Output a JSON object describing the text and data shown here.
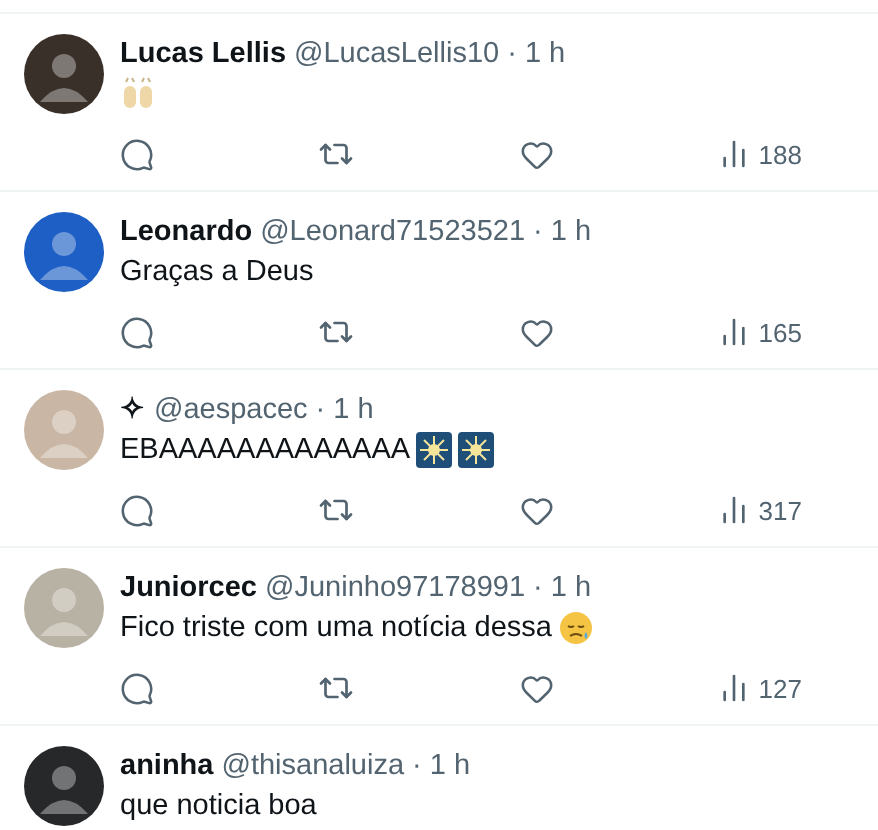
{
  "replies": [
    {
      "name": "Lucas Lellis",
      "handle": "@LucasLellis10",
      "separator": "·",
      "time": "1 h",
      "emojis": [
        {
          "kind": "raised-hands"
        }
      ],
      "views": "188",
      "avatar": {
        "color": "#3a302a"
      }
    },
    {
      "name": "Leonardo",
      "handle": "@Leonard71523521",
      "separator": "·",
      "time": "1 h",
      "text": "Graças a Deus",
      "views": "165",
      "avatar": {
        "color": "#1d5fc4"
      }
    },
    {
      "name": "✧",
      "handle": "@aespacec",
      "separator": "·",
      "time": "1 h",
      "text": "EBAAAAAAAAAAAAA",
      "emojis": [
        {
          "kind": "fireworks"
        },
        {
          "kind": "fireworks"
        }
      ],
      "views": "317",
      "avatar": {
        "color": "#c9b6a4"
      }
    },
    {
      "name": "Juniorcec",
      "handle": "@Juninho97178991",
      "separator": "·",
      "time": "1 h",
      "text": "Fico triste com uma notícia dessa",
      "emojis": [
        {
          "kind": "sad-face"
        }
      ],
      "views": "127",
      "avatar": {
        "color": "#b8b2a4"
      }
    },
    {
      "name": "aninha",
      "handle": "@thisanaluiza",
      "separator": "·",
      "time": "1 h",
      "text": "que noticia boa",
      "avatar": {
        "color": "#26282a"
      }
    }
  ]
}
